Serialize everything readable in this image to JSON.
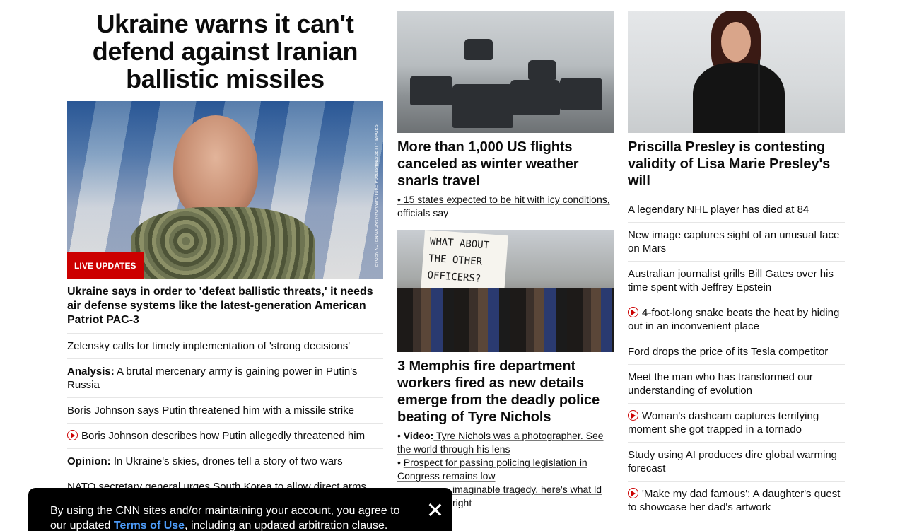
{
  "left": {
    "hero_title": "Ukraine warns it can't defend against Iranian ballistic missiles",
    "image_credit": "EVGEN KOTENKO/UKRINFORM/FUTURE PUBLISHING/GETTY IMAGES",
    "badge": "LIVE UPDATES",
    "lead_headline": "Ukraine says in order to 'defeat ballistic threats,' it needs air defense systems like the latest-generation American Patriot PAC-3",
    "items": [
      {
        "prefix": "",
        "text": "Zelensky calls for timely implementation of 'strong decisions'"
      },
      {
        "prefix": "Analysis:",
        "text": " A brutal mercenary army is gaining power in Putin's Russia"
      },
      {
        "prefix": "",
        "text": "Boris Johnson says Putin threatened him with a missile strike"
      },
      {
        "prefix": "",
        "text": "Boris Johnson describes how Putin allegedly threatened him",
        "video": true
      },
      {
        "prefix": "Opinion:",
        "text": " In Ukraine's skies, drones tell a story of two wars"
      },
      {
        "prefix": "",
        "text": "NATO secretary general urges South Korea to allow direct arms exports to Ukraine"
      }
    ]
  },
  "middle": {
    "card1": {
      "headline": "More than 1,000 US flights canceled as winter weather snarls travel",
      "sub": "• 15 states expected to be hit with icy conditions, officials say"
    },
    "card2": {
      "sign_text": "WHAT ABOUT THE OTHER OFFICERS?",
      "headline": "3 Memphis fire department workers fired as new details emerge from the deadly police beating of Tyre Nichols",
      "subs": [
        {
          "bullet": "• ",
          "prefix": "Video:",
          "text": " Tyre Nichols was a photographer. See the world through his lens"
        },
        {
          "bullet": "• ",
          "prefix": "",
          "text": "Prospect for passing policing legislation in Congress remains low"
        },
        {
          "bullet": "",
          "prefix": "",
          "text": "imaginable tragedy, here's what ld right"
        }
      ]
    }
  },
  "right": {
    "headline": "Priscilla Presley is contesting validity of Lisa Marie Presley's will",
    "items": [
      {
        "text": "A legendary NHL player has died at 84",
        "video": false
      },
      {
        "text": "New image captures sight of an unusual face on Mars",
        "video": false
      },
      {
        "text": "Australian journalist grills Bill Gates over his time spent with Jeffrey Epstein",
        "video": false
      },
      {
        "text": "4-foot-long snake beats the heat by hiding out in an inconvenient place",
        "video": true
      },
      {
        "text": "Ford drops the price of its Tesla competitor",
        "video": false
      },
      {
        "text": "Meet the man who has transformed our understanding of evolution",
        "video": false
      },
      {
        "text": "Woman's dashcam captures terrifying moment she got trapped in a tornado",
        "video": true
      },
      {
        "text": "Study using AI produces dire global warming forecast",
        "video": false
      },
      {
        "text": "'Make my dad famous': A daughter's quest to showcase her dad's artwork",
        "video": true
      }
    ]
  },
  "consent": {
    "text_before": "By using the CNN sites and/or maintaining your account, you agree to our updated ",
    "link": "Terms of Use",
    "text_after": ", including an updated arbitration clause."
  },
  "colors": {
    "accent": "#cc0000",
    "link": "#4d9bf8",
    "divider": "#e6e6e6"
  }
}
